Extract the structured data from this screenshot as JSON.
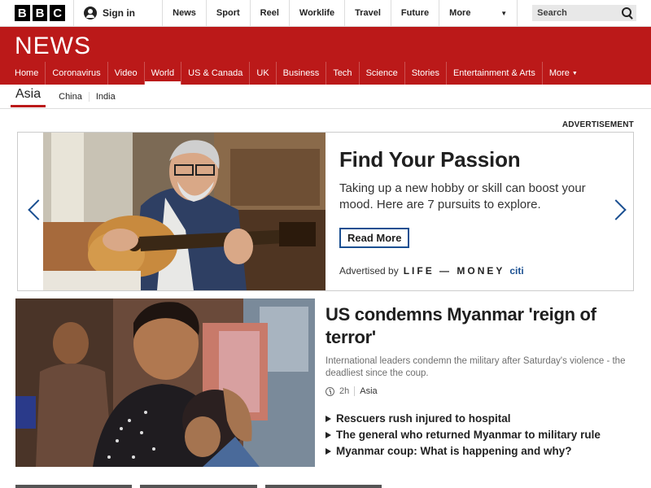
{
  "bbc": {
    "logo_letters": [
      "B",
      "B",
      "C"
    ],
    "signin_label": "Sign in"
  },
  "topnav": [
    "News",
    "Sport",
    "Reel",
    "Worklife",
    "Travel",
    "Future",
    "More"
  ],
  "search": {
    "placeholder": "Search"
  },
  "news": {
    "wordmark": "NEWS",
    "sections": [
      "Home",
      "Coronavirus",
      "Video",
      "World",
      "US & Canada",
      "UK",
      "Business",
      "Tech",
      "Science",
      "Stories",
      "Entertainment & Arts",
      "More"
    ],
    "active_section": "World"
  },
  "subnav": {
    "current": "Asia",
    "items": [
      "China",
      "India"
    ]
  },
  "ad": {
    "label": "ADVERTISEMENT",
    "title": "Find Your Passion",
    "body": "Taking up a new hobby or skill can boost your mood. Here are 7 pursuits to explore.",
    "button": "Read More",
    "advertised_by": "Advertised by",
    "brand": "LIFE — MONEY",
    "sponsor": "citi"
  },
  "story": {
    "title": "US condemns Myanmar 'reign of terror'",
    "summary": "International leaders condemn the military after Saturday's violence - the deadliest since the coup.",
    "time": "2h",
    "tag": "Asia",
    "related": [
      "Rescuers rush injured to hospital",
      "The general who returned Myanmar to military rule",
      "Myanmar coup: What is happening and why?"
    ]
  },
  "colors": {
    "news_red": "#bb1919",
    "ad_accent": "#1a4f91"
  }
}
